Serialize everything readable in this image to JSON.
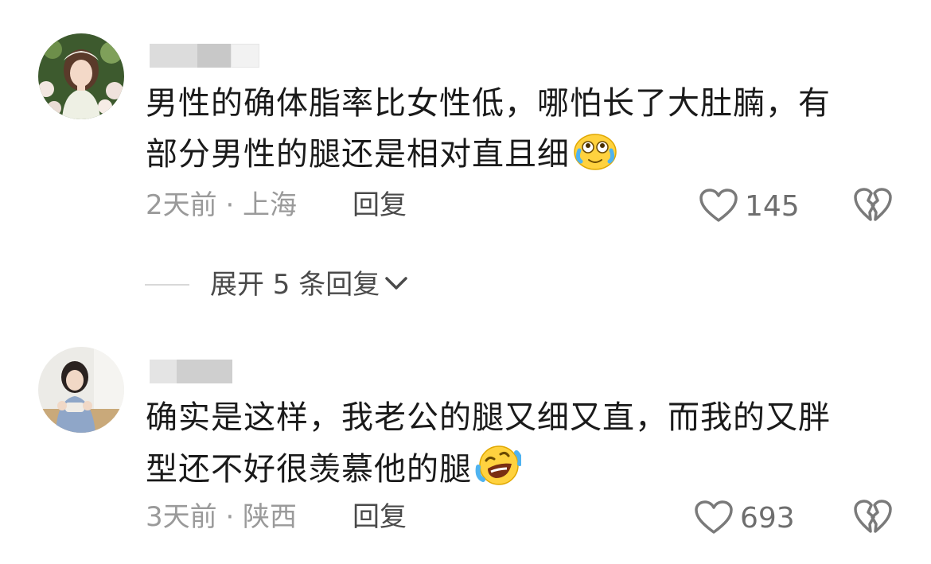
{
  "comments": [
    {
      "text_line1": "男性的确体脂率比女性低，哪怕长了大肚腩，有",
      "text_line2": "部分男性的腿还是相对直且细",
      "emoji": "crying-laughing-face",
      "time": "2天前",
      "location": "上海",
      "meta": "2天前 · 上海",
      "reply_label": "回复",
      "likes": "145"
    },
    {
      "text_line1": "确实是这样，我老公的腿又细又直，而我的又胖",
      "text_line2": "型还不好很羡慕他的腿",
      "emoji": "rolling-laughing-face",
      "time": "3天前",
      "location": "陕西",
      "meta": "3天前 · 陕西",
      "reply_label": "回复",
      "likes": "693"
    }
  ],
  "expand_replies": {
    "label": "展开 5 条回复"
  },
  "colors": {
    "text": "#1a1a1a",
    "meta": "#9a9a9a",
    "action": "#4a4a4a",
    "icon": "#7a7a7a"
  },
  "icons": [
    "heart-icon",
    "broken-heart-icon",
    "chevron-down-icon"
  ]
}
